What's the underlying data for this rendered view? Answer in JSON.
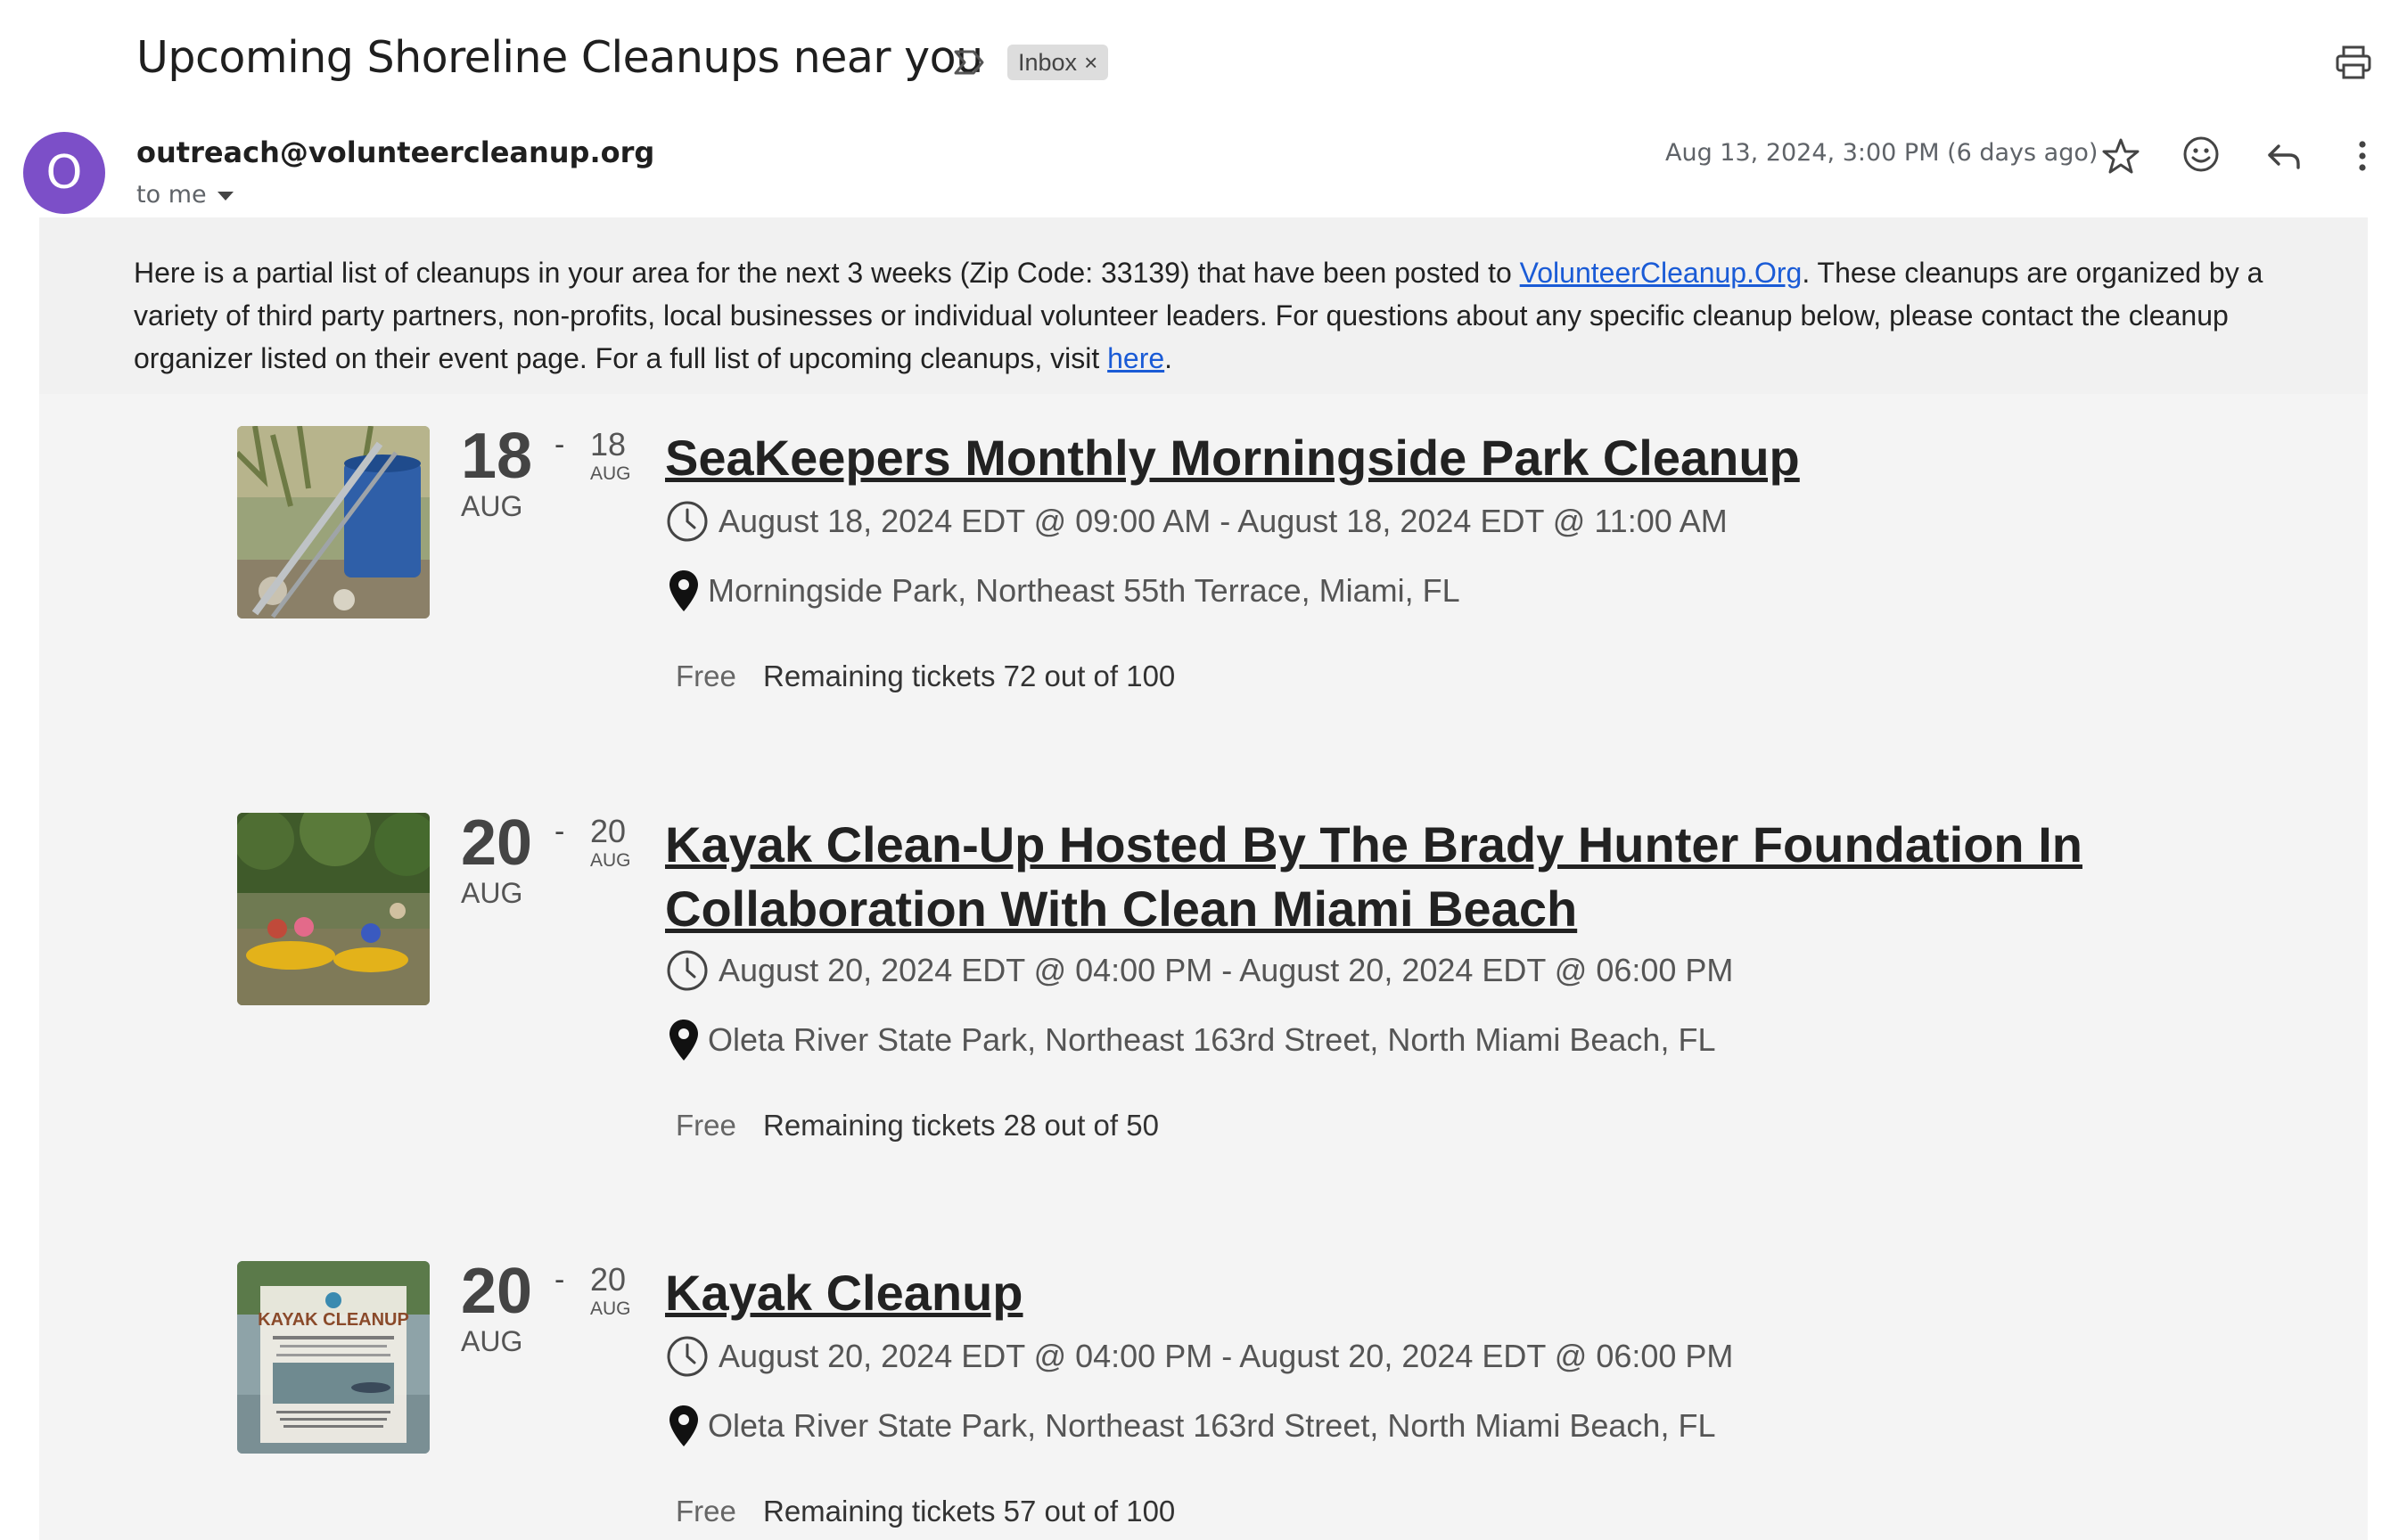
{
  "header": {
    "subject": "Upcoming Shoreline Cleanups near you",
    "label_chip": "Inbox",
    "label_close": "×"
  },
  "message": {
    "avatar_letter": "O",
    "avatar_color": "#7c4fc8",
    "sender": "outreach@volunteercleanup.org",
    "recipient": "to me",
    "date": "Aug 13, 2024, 3:00 PM (6 days ago)"
  },
  "intro": {
    "text_1": "Here is a partial list of cleanups in your area for the next 3 weeks (Zip Code: 33139) that have been posted to ",
    "link_1": "VolunteerCleanup.Org",
    "text_2": ". These cleanups are organized by a variety of third party partners, non-profits, local businesses or individual volunteer leaders. For questions about any specific cleanup below, please contact the cleanup organizer listed on their event page. For a full list of upcoming cleanups, visit ",
    "link_2": "here",
    "text_3": "."
  },
  "events": [
    {
      "start_day": "18",
      "start_month": "AUG",
      "dash": "-",
      "end_day": "18",
      "end_month": "AUG",
      "title": "SeaKeepers Monthly Morningside Park Cleanup",
      "when": "August 18, 2024 EDT @ 09:00 AM - August 18, 2024 EDT @ 11:00 AM",
      "where": "Morningside Park, Northeast 55th Terrace, Miami, FL",
      "price": "Free",
      "tickets": "Remaining tickets 72 out of 100"
    },
    {
      "start_day": "20",
      "start_month": "AUG",
      "dash": "-",
      "end_day": "20",
      "end_month": "AUG",
      "title": "Kayak Clean-Up Hosted By The Brady Hunter Foundation In Collaboration With Clean Miami Beach",
      "when": "August 20, 2024 EDT @ 04:00 PM - August 20, 2024 EDT @ 06:00 PM",
      "where": "Oleta River State Park, Northeast 163rd Street, North Miami Beach, FL",
      "price": "Free",
      "tickets": "Remaining tickets 28 out of 50"
    },
    {
      "start_day": "20",
      "start_month": "AUG",
      "dash": "-",
      "end_day": "20",
      "end_month": "AUG",
      "title": "Kayak Cleanup",
      "when": "August 20, 2024 EDT @ 04:00 PM - August 20, 2024 EDT @ 06:00 PM",
      "where": "Oleta River State Park, Northeast 163rd Street, North Miami Beach, FL",
      "price": "Free",
      "tickets": "Remaining tickets 57 out of 100",
      "poster_text": "KAYAK CLEANUP"
    }
  ]
}
